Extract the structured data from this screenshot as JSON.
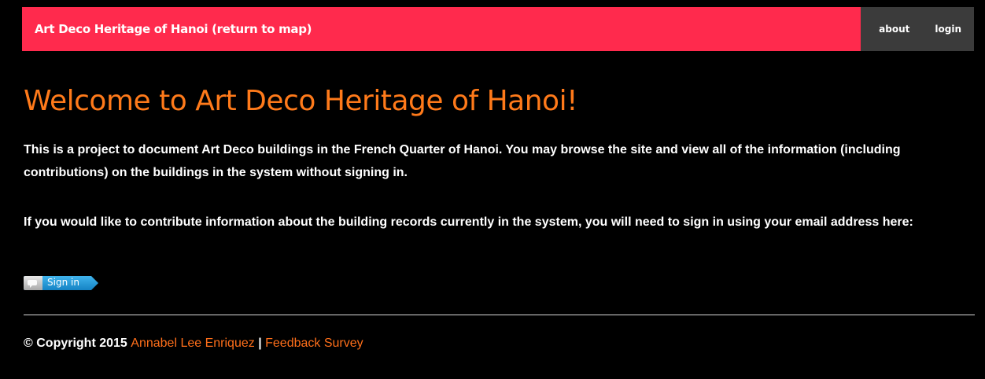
{
  "nav": {
    "brand": "Art Deco Heritage of Hanoi (return to map)",
    "about": "about",
    "login": "login"
  },
  "main": {
    "title": "Welcome to Art Deco Heritage of Hanoi!",
    "paragraph1": "This is a project to document Art Deco buildings in the French Quarter of Hanoi. You may browse the site and view all of the information (including contributions) on the buildings in the system without signing in.",
    "paragraph2": "If you would like to contribute information about the building records currently in the system, you will need to sign in using your email address here:",
    "signin_label": "Sign in",
    "signin_icon": "persona-icon"
  },
  "footer": {
    "copyright": "© Copyright 2015",
    "author_link": "Annabel Lee Enriquez",
    "separator": "|",
    "survey_link": "Feedback Survey"
  },
  "colors": {
    "navbar": "#ff2a4d",
    "nav_right": "#3b3b3b",
    "title": "#ff7a1a",
    "link": "#ff6f1a",
    "signin": "#1e9ad6"
  }
}
